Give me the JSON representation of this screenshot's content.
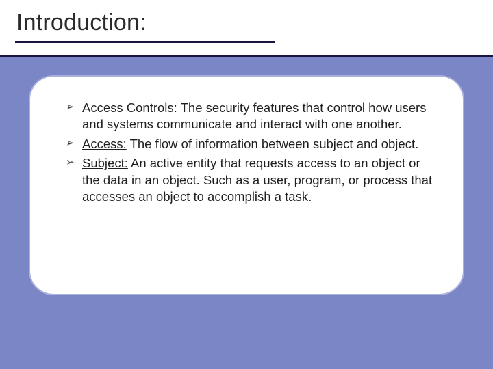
{
  "slide": {
    "title": "Introduction:",
    "bullets": [
      {
        "term": "Access Controls:",
        "desc": "  The security features that control how users and systems communicate and interact with one another."
      },
      {
        "term": "Access:",
        "desc": "  The flow of information between subject and object."
      },
      {
        "term": "Subject:",
        "desc": "  An active entity that requests access to an object or the data in an object. Such as a user, program, or process that accesses an object to accomplish a task."
      }
    ]
  }
}
